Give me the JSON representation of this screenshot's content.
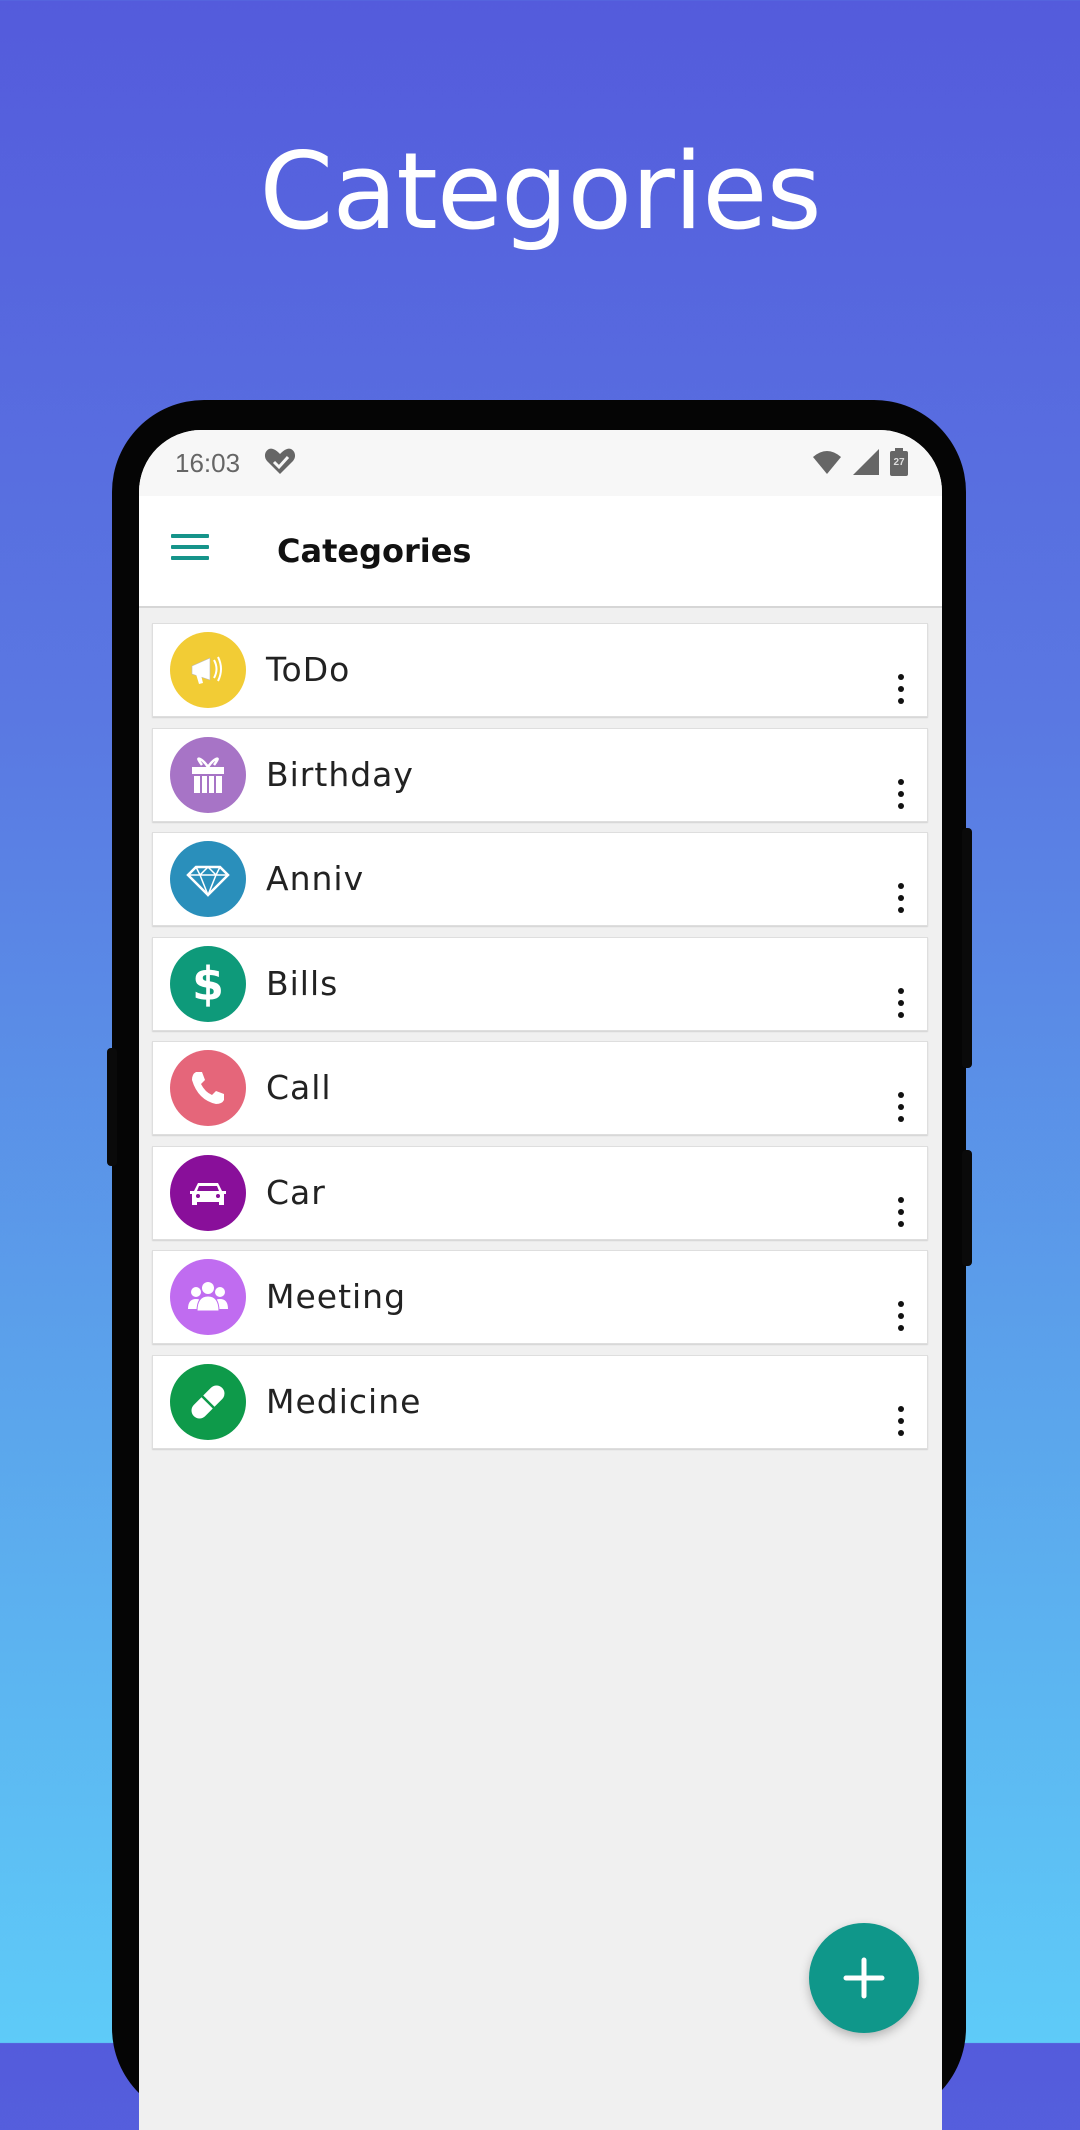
{
  "promo": {
    "title": "Categories"
  },
  "status_bar": {
    "time": "16:03",
    "notification_icon": "heart-check-icon",
    "wifi_icon": "wifi-icon",
    "signal_icon": "signal-icon",
    "battery_level": "27"
  },
  "app_bar": {
    "menu_icon": "hamburger-menu-icon",
    "title": "Categories"
  },
  "categories": [
    {
      "label": "ToDo",
      "icon": "megaphone-icon",
      "color": "#f2cc35"
    },
    {
      "label": "Birthday",
      "icon": "gift-icon",
      "color": "#a774c6"
    },
    {
      "label": "Anniv",
      "icon": "diamond-icon",
      "color": "#2a8fbb"
    },
    {
      "label": "Bills",
      "icon": "dollar-icon",
      "color": "#0e9a7a"
    },
    {
      "label": "Call",
      "icon": "phone-icon",
      "color": "#e5667a"
    },
    {
      "label": "Car",
      "icon": "car-icon",
      "color": "#890f9a"
    },
    {
      "label": "Meeting",
      "icon": "people-icon",
      "color": "#c06cf0"
    },
    {
      "label": "Medicine",
      "icon": "pill-icon",
      "color": "#0e9a4a"
    }
  ],
  "fab": {
    "icon": "plus-icon",
    "color": "#0f978a"
  },
  "colors": {
    "accent": "#16948a"
  }
}
